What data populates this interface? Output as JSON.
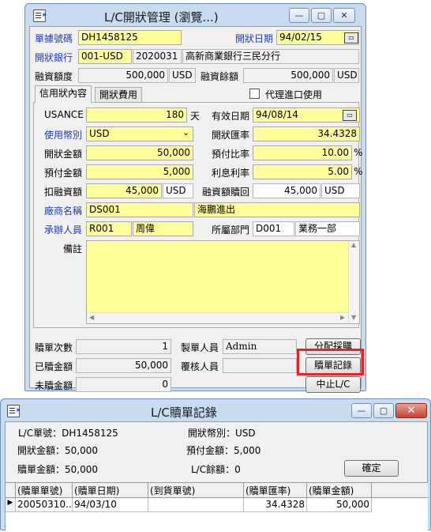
{
  "main_window": {
    "title": "L/C開狀管理 (瀏覽...)",
    "minimize_glyph": "—",
    "maximize_glyph": "▢",
    "close_glyph": "✕",
    "fields": {
      "doc_no_label": "單據號碼",
      "doc_no": "DH1458125",
      "open_date_label": "開狀日期",
      "open_date": "94/02/15",
      "bank_label": "開狀銀行",
      "bank_currency": "001-USD",
      "bank_code": "2020031",
      "bank_name": "高新商業銀行三民分行",
      "credit_limit_label": "融資額度",
      "credit_limit": "500,000",
      "credit_limit_currency": "USD",
      "credit_balance_label": "融資餘額",
      "credit_balance": "500,000",
      "credit_balance_currency": "USD"
    },
    "tabs": [
      "信用狀內容",
      "開狀費用"
    ],
    "proxy_import_label": "代理進口使用",
    "proxy_import_checked": false,
    "lc": {
      "usance_label": "USANCE",
      "usance": "180",
      "usance_unit": "天",
      "expiry_label": "有效日期",
      "expiry": "94/08/14",
      "currency_label": "使用幣別",
      "currency": "USD",
      "rate_label": "開狀匯率",
      "rate": "34.4328",
      "amount_label": "開狀金額",
      "amount": "50,000",
      "prepay_ratio_label": "預付比率",
      "prepay_ratio": "10.00",
      "percent_sign": "%",
      "prepay_amount_label": "預付金額",
      "prepay_amount": "5,000",
      "interest_label": "利息利率",
      "interest_rate": "5.00",
      "deduct_label": "扣融資額",
      "deduct": "45,000",
      "deduct_currency": "USD",
      "redeem_label": "融資額贖回",
      "redeem": "45,000",
      "redeem_currency": "USD",
      "vendor_label": "廠商名稱",
      "vendor_code": "DS001",
      "vendor_name": "海鵬進出",
      "handler_label": "承辦人員",
      "handler_code": "R001",
      "handler_name": "周偉",
      "dept_label": "所屬部門",
      "dept_code": "D001",
      "dept_name": "業務一部",
      "remark_label": "備註",
      "remark": ""
    },
    "footer": {
      "redeem_count_label": "贖單次數",
      "redeem_count": "1",
      "maker_label": "製單人員",
      "maker": "Admin",
      "allocate_button": "分配採購",
      "redeemed_amount_label": "已贖金額",
      "redeemed_amount": "50,000",
      "reviewer_label": "覆核人員",
      "reviewer": "",
      "redeem_record_button": "贖單記錄",
      "unredeemed_label": "未贖金額",
      "unredeemed": "0",
      "stop_button": "中止L/C"
    }
  },
  "record_window": {
    "title": "L/C贖單記錄",
    "lc_no": "L/C單號：DH1458125",
    "currency": "開狀幣別：USD",
    "open_amount": "開狀金額：50,000",
    "prepay_amount": "預付金額：5,000",
    "redeem_amount": "贖單金額：50,000",
    "lc_balance": "L/C餘額：0",
    "confirm_button": "確定",
    "columns": [
      "(贖單單號)",
      "(贖單日期)",
      "(到貨單號)",
      "(贖單匯率)",
      "(贖單金額)"
    ],
    "rows": [
      [
        "20050310...",
        "94/03/10",
        "",
        "34.4328",
        "50,000"
      ]
    ]
  },
  "colors": {
    "required_field": "#ffff99",
    "highlight": "#e8222b",
    "blue_label": "#1a3db8"
  }
}
